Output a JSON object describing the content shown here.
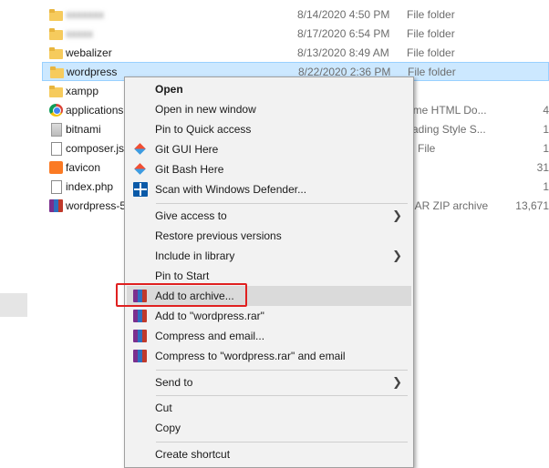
{
  "file_list": [
    {
      "name": "",
      "name_blurred": "xxxxxxx",
      "date": "8/14/2020 4:50 PM",
      "type": "File folder",
      "size": "",
      "icon": "folder-icon"
    },
    {
      "name": "",
      "name_blurred": "xxxxx",
      "date": "8/17/2020 6:54 PM",
      "type": "File folder",
      "size": "",
      "icon": "folder-icon"
    },
    {
      "name": "webalizer",
      "date": "8/13/2020 8:49 AM",
      "type": "File folder",
      "size": "",
      "icon": "folder-icon"
    },
    {
      "name": "wordpress",
      "date": "8/22/2020 2:36 PM",
      "type": "File folder",
      "size": "",
      "icon": "folder-icon",
      "selected": true
    },
    {
      "name": "xampp",
      "date": "",
      "type": "",
      "size": "",
      "icon": "folder-icon"
    },
    {
      "name": "applications",
      "date": "",
      "type": "ome HTML Do...",
      "size": "4",
      "icon": "chrome-icon"
    },
    {
      "name": "bitnami",
      "date": "",
      "type": "cading Style S...",
      "size": "1",
      "icon": "bitnami-icon"
    },
    {
      "name": "composer.js",
      "date": "",
      "type": "N File",
      "size": "1",
      "icon": "document-icon"
    },
    {
      "name": "favicon",
      "date": "",
      "type": "",
      "size": "31",
      "icon": "xampp-icon"
    },
    {
      "name": "index.php",
      "date": "",
      "type": "",
      "size": "1",
      "icon": "document-icon"
    },
    {
      "name": "wordpress-5",
      "date": "",
      "type": "RAR ZIP archive",
      "size": "13,671",
      "icon": "winrar-icon"
    }
  ],
  "context_menu": {
    "items": [
      {
        "label": "Open",
        "bold": true
      },
      {
        "label": "Open in new window"
      },
      {
        "label": "Pin to Quick access"
      },
      {
        "label": "Git GUI Here",
        "icon": "git-icon"
      },
      {
        "label": "Git Bash Here",
        "icon": "git-icon"
      },
      {
        "label": "Scan with Windows Defender...",
        "icon": "defender-icon"
      },
      {
        "label": "Give access to",
        "submenu": true
      },
      {
        "label": "Restore previous versions"
      },
      {
        "label": "Include in library",
        "submenu": true
      },
      {
        "label": "Pin to Start"
      },
      {
        "label": "Add to archive...",
        "icon": "winrar-icon",
        "highlighted": true
      },
      {
        "label": "Add to \"wordpress.rar\"",
        "icon": "winrar-icon"
      },
      {
        "label": "Compress and email...",
        "icon": "winrar-icon"
      },
      {
        "label": "Compress to \"wordpress.rar\" and email",
        "icon": "winrar-icon"
      },
      {
        "label": "Send to",
        "submenu": true
      },
      {
        "label": "Cut"
      },
      {
        "label": "Copy"
      },
      {
        "label": "Create shortcut"
      }
    ],
    "chevron": "❯"
  },
  "colors": {
    "selection": "#cce8ff",
    "menu_bg": "#f2f2f2",
    "annotation_box": "#e02020"
  }
}
